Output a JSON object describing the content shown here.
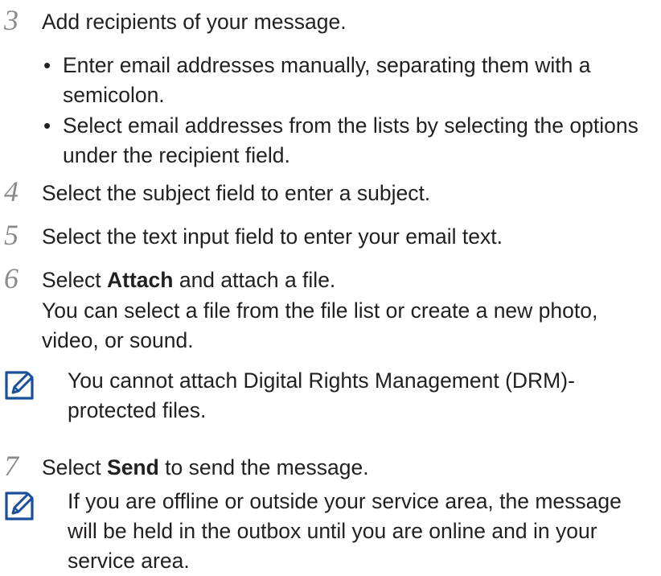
{
  "steps": [
    {
      "number": "3",
      "text": "Add recipients of your message.",
      "bullets": [
        "Enter email addresses manually, separating them with a semicolon.",
        "Select email addresses from the lists by selecting the options under the recipient field."
      ]
    },
    {
      "number": "4",
      "text": "Select the subject field to enter a subject."
    },
    {
      "number": "5",
      "text": "Select the text input field to enter your email text."
    },
    {
      "number": "6",
      "prefix": "Select ",
      "bold": "Attach",
      "suffix": " and attach a file.",
      "detail": "You can select a file from the file list or create a new photo, video, or sound."
    },
    {
      "number": "7",
      "prefix": "Select ",
      "bold": "Send",
      "suffix": " to send the message."
    }
  ],
  "notes": [
    {
      "icon": "note-pencil-icon",
      "text": "You cannot attach Digital Rights Management (DRM)-protected files."
    },
    {
      "icon": "note-pencil-icon",
      "text": "If you are offline or outside your service area, the message will be held in the outbox until you are online and in your service area."
    }
  ]
}
